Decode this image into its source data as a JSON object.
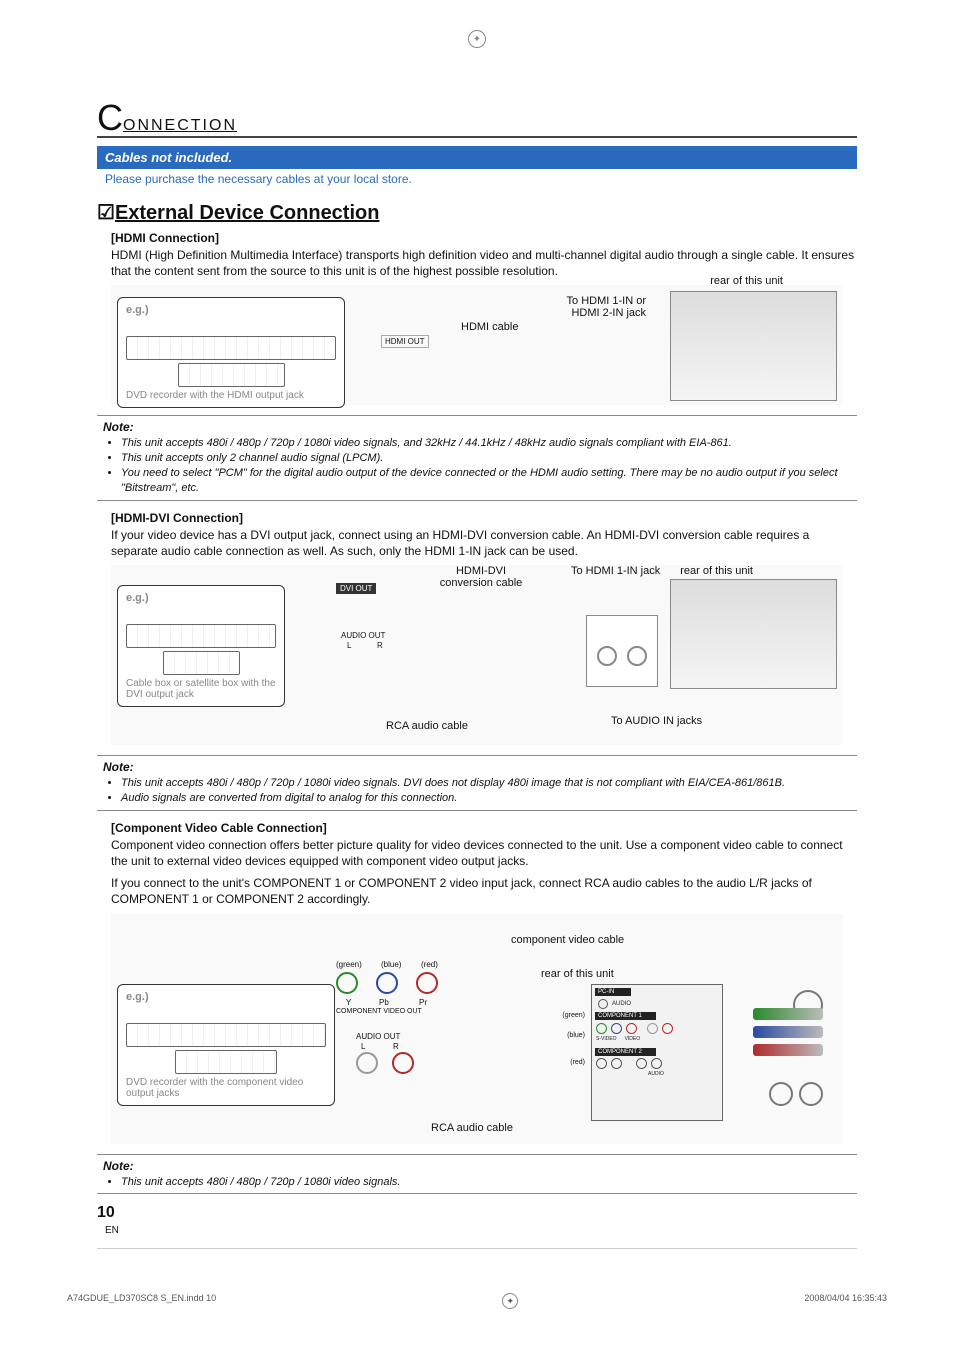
{
  "section": {
    "title_first_letter": "C",
    "title_rest": "ONNECTION"
  },
  "banner": {
    "title": "Cables not included.",
    "subtitle": "Please purchase the necessary cables at your local store."
  },
  "main_heading": "External Device Connection",
  "hdmi": {
    "heading": "[HDMI Connection]",
    "body": "HDMI (High Definition Multimedia Interface) transports high definition video and multi-channel digital audio through a single cable. It ensures that the content sent from the source to this unit is of the highest possible resolution.",
    "diagram": {
      "eg": "e.g.)",
      "device_caption": "DVD recorder with the HDMI output jack",
      "hdmi_out_label": "HDMI OUT",
      "cable_label": "HDMI cable",
      "jack_label": "To HDMI 1-IN or HDMI 2-IN jack",
      "rear_label": "rear of this unit"
    },
    "note_title": "Note:",
    "notes": [
      "This unit accepts 480i / 480p / 720p / 1080i video signals, and 32kHz / 44.1kHz / 48kHz audio signals compliant with EIA-861.",
      "This unit accepts only 2 channel audio signal (LPCM).",
      "You need to select \"PCM\" for the digital audio output of the device connected or the HDMI audio setting. There may be no audio output if you select \"Bitstream\", etc."
    ]
  },
  "hdmi_dvi": {
    "heading": "[HDMI-DVI Connection]",
    "body": "If your video device has a DVI output jack, connect using an HDMI-DVI conversion cable. An HDMI-DVI conversion cable requires a separate audio cable connection as well. As such, only the HDMI 1-IN jack can be used.",
    "diagram": {
      "eg": "e.g.)",
      "device_caption": "Cable box or satellite box with the DVI output jack",
      "dvi_out_label": "DVI OUT",
      "audio_out_label": "AUDIO OUT",
      "audio_L": "L",
      "audio_R": "R",
      "conversion_cable_label": "HDMI-DVI conversion cable",
      "rca_label": "RCA audio cable",
      "hdmi_jack_label": "To HDMI 1-IN jack",
      "audio_in_label": "To AUDIO IN jacks",
      "rear_label": "rear of this unit"
    },
    "note_title": "Note:",
    "notes": [
      "This unit accepts 480i / 480p / 720p / 1080i video signals. DVI does not display 480i image that is not compliant with EIA/CEA-861/861B.",
      "Audio signals are converted from digital to analog for this connection."
    ]
  },
  "component": {
    "heading": "[Component Video Cable Connection]",
    "body1": "Component video connection offers better picture quality for video devices connected to the unit. Use a component video cable to connect the unit to external video devices equipped with component video output jacks.",
    "body2": "If you connect to the unit's COMPONENT 1 or COMPONENT 2 video input jack, connect RCA audio cables to the audio L/R jacks of COMPONENT 1 or COMPONENT 2 accordingly.",
    "diagram": {
      "eg": "e.g.)",
      "device_caption": "DVD recorder with the component video output jacks",
      "component_out_label": "COMPONENT VIDEO OUT",
      "y_label": "Y",
      "pb_label": "Pb",
      "pr_label": "Pr",
      "color_green": "(green)",
      "color_blue": "(blue)",
      "color_red": "(red)",
      "audio_out_label": "AUDIO OUT",
      "audio_L": "L",
      "audio_R": "R",
      "comp_cable_label": "component video cable",
      "rca_label": "RCA audio cable",
      "rear_label": "rear of this unit",
      "panel_pc_in": "PC-IN",
      "panel_audio": "AUDIO",
      "panel_comp1": "COMPONENT 1",
      "panel_comp2": "COMPONENT 2",
      "panel_svideo": "S-VIDEO",
      "panel_video": "VIDEO"
    },
    "note_title": "Note:",
    "notes": [
      "This unit accepts 480i / 480p / 720p / 1080i video signals."
    ]
  },
  "page_number": "10",
  "page_lang": "EN",
  "footer": {
    "file_info": "A74GDUE_LD370SC8 S_EN.indd   10",
    "timestamp": "2008/04/04   16:35:43"
  }
}
